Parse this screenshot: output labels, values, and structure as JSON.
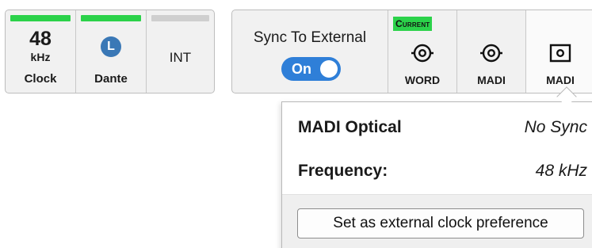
{
  "clock_panel": {
    "clock": {
      "value": "48",
      "unit": "kHz",
      "label": "Clock",
      "status_color": "#2bd24a"
    },
    "dante": {
      "badge": "L",
      "label": "Dante",
      "status_color": "#2bd24a"
    },
    "int": {
      "label": "INT",
      "status_color": "#cfcfcf"
    }
  },
  "sync": {
    "label": "Sync To External",
    "toggle_label": "On",
    "toggle_color": "#2f7fd8"
  },
  "sources": [
    {
      "label": "WORD",
      "badge": "Current",
      "icon": "bnc-connector-icon",
      "status_color": "#2bd24a"
    },
    {
      "label": "MADI",
      "icon": "bnc-connector-icon",
      "status_color": "#cfcfcf"
    },
    {
      "label": "MADI",
      "icon": "optical-connector-icon",
      "status_color": "#fbf1c0"
    }
  ],
  "popover": {
    "title": "MADI Optical",
    "status": "No Sync",
    "frequency_label": "Frequency:",
    "frequency_value": "48 kHz",
    "action_label": "Set as external clock preference"
  }
}
